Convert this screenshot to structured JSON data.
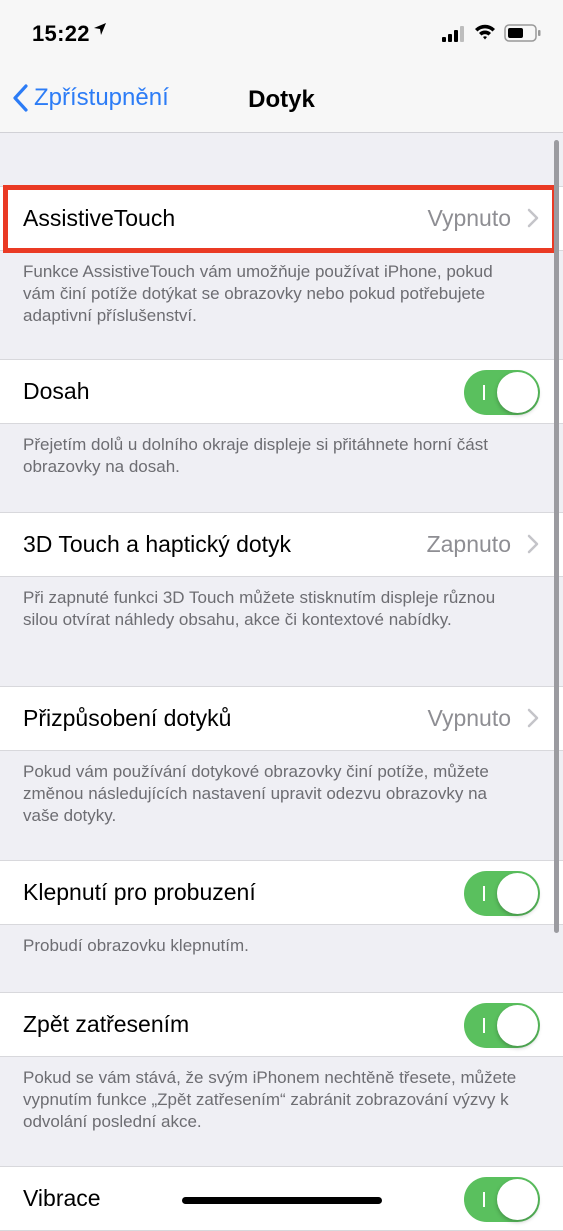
{
  "status": {
    "time": "15:22"
  },
  "nav": {
    "back_label": "Zpřístupnění",
    "title": "Dotyk"
  },
  "rows": [
    {
      "label": "AssistiveTouch",
      "value": "Vypnuto",
      "note": "Funkce AssistiveTouch vám umožňuje používat iPhone, pokud vám činí potíže dotýkat se obrazovky nebo pokud potřebujete adaptivní příslušenství."
    },
    {
      "label": "Dosah",
      "toggle_on": true,
      "note": "Přejetím dolů u dolního okraje displeje si přitáhnete horní část obrazovky na dosah."
    },
    {
      "label": "3D Touch a haptický dotyk",
      "value": "Zapnuto",
      "note": "Při zapnuté funkci 3D Touch můžete stisknutím displeje různou silou otvírat náhledy obsahu, akce či kontextové nabídky."
    },
    {
      "label": "Přizpůsobení dotyků",
      "value": "Vypnuto",
      "note": "Pokud vám používání dotykové obrazovky činí potíže, můžete změnou následujících nastavení upravit odezvu obrazovky na vaše dotyky."
    },
    {
      "label": "Klepnutí pro probuzení",
      "toggle_on": true,
      "note": "Probudí obrazovku klepnutím."
    },
    {
      "label": "Zpět zatřesením",
      "toggle_on": true,
      "note": "Pokud se vám stává, že svým iPhonem nechtěně třesete, můžete vypnutím funkce „Zpět zatřesením“ zabránit zobrazování výzvy k odvolání poslední akce."
    },
    {
      "label": "Vibrace",
      "toggle_on": true
    }
  ],
  "colors": {
    "accent": "#2c7cf6",
    "toggle_on": "#5ac05e",
    "highlight": "#ea3a24"
  }
}
